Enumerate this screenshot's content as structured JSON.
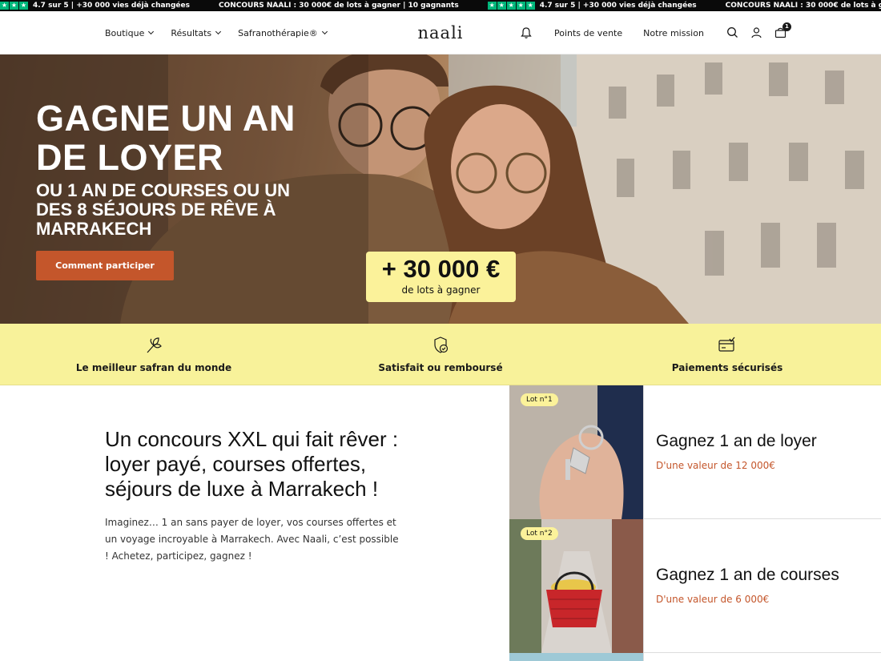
{
  "ticker": {
    "rating_text": "4.7 sur 5 | +30 000 vies déjà changées",
    "contest_text": "CONCOURS NAALI : 30 000€ de lots à gagner | 10 gagnants",
    "star_glyph": "★",
    "star_color": "#00b67a"
  },
  "header": {
    "logo": "naali",
    "nav": [
      {
        "label": "Boutique"
      },
      {
        "label": "Résultats"
      },
      {
        "label": "Safranothérapie®"
      }
    ],
    "links": {
      "stores": "Points de vente",
      "mission": "Notre mission"
    },
    "cart_count": "1",
    "icons": [
      "bell-icon",
      "search-icon",
      "user-icon",
      "cart-icon"
    ]
  },
  "hero": {
    "title": "GAGNE UN AN DE LOYER",
    "subtitle": "OU 1 AN DE COURSES OU UN DES 8 SÉJOURS DE RÊVE À MARRAKECH",
    "cta": "Comment participer",
    "prize_amount": "+ 30 000 €",
    "prize_caption": "de lots à gagner"
  },
  "features": [
    {
      "label": "Le meilleur safran du monde",
      "icon": "saffron-flower-icon"
    },
    {
      "label": "Satisfait ou remboursé",
      "icon": "shield-check-icon"
    },
    {
      "label": "Paiements sécurisés",
      "icon": "card-check-icon"
    }
  ],
  "intro": {
    "heading": "Un concours XXL qui fait rêver : loyer payé, courses offertes, séjours de luxe à Marrakech !",
    "body": "Imaginez… 1 an sans payer de loyer, vos courses offertes et un voyage incroyable à Marrakech.  Avec Naali, c’est possible ! Achetez, participez, gagnez !"
  },
  "lots": [
    {
      "badge": "Lot n°1",
      "title": "Gagnez 1 an de loyer",
      "value": "D'une valeur de 12 000€"
    },
    {
      "badge": "Lot n°2",
      "title": "Gagnez 1 an de courses",
      "value": "D'une valeur de 6 000€"
    }
  ],
  "colors": {
    "accent": "#c4562b",
    "yellow": "#f8f29a",
    "dark": "#0a0a0a"
  }
}
